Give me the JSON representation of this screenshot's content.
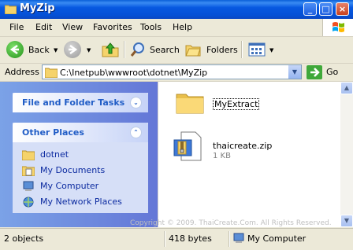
{
  "window": {
    "title": "MyZip"
  },
  "menu": [
    "File",
    "Edit",
    "View",
    "Favorites",
    "Tools",
    "Help"
  ],
  "toolbar": {
    "back": "Back",
    "search": "Search",
    "folders": "Folders"
  },
  "address": {
    "label": "Address",
    "path": "C:\\Inetpub\\wwwroot\\dotnet\\MyZip",
    "go": "Go"
  },
  "tasks": {
    "file_folder": "File and Folder Tasks",
    "other_places": "Other Places",
    "places": [
      {
        "label": "dotnet",
        "icon": "folder-icon"
      },
      {
        "label": "My Documents",
        "icon": "my-documents-icon"
      },
      {
        "label": "My Computer",
        "icon": "my-computer-icon"
      },
      {
        "label": "My Network Places",
        "icon": "network-places-icon"
      }
    ]
  },
  "files": [
    {
      "name": "MyExtract",
      "type": "folder"
    },
    {
      "name": "thaicreate.zip",
      "size": "1 KB",
      "type": "zip"
    }
  ],
  "watermark": "Copyright © 2009. ThaiCreate.Com. All Rights Reserved.",
  "status": {
    "objects": "2 objects",
    "size": "418 bytes",
    "location": "My Computer"
  }
}
